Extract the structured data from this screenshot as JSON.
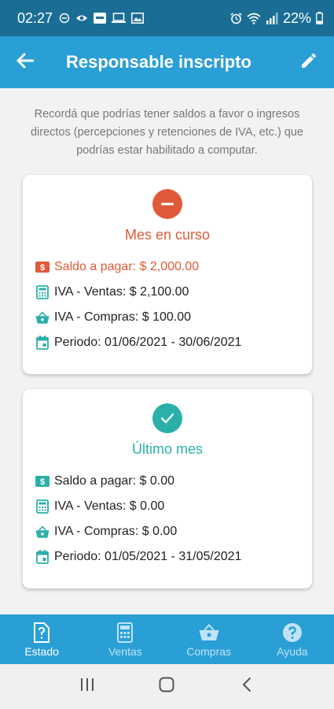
{
  "status_bar": {
    "time": "02:27",
    "battery": "22%",
    "icons_left": [
      "do-not-disturb-icon",
      "eye-icon",
      "app-icon",
      "laptop-icon",
      "gallery-icon"
    ],
    "icons_right": [
      "alarm-icon",
      "wifi-icon",
      "signal-icon",
      "battery-icon"
    ]
  },
  "app_bar": {
    "title": "Responsable inscripto",
    "back_icon": "arrow-back-icon",
    "edit_icon": "edit-pencil-icon"
  },
  "notice": "Recordá que podrías tener saldos a favor o ingresos directos (percepciones y retenciones de IVA, etc.) que podrías estar habilitado a computar.",
  "cards": [
    {
      "title": "Mes en curso",
      "badge_icon": "minus-circle-icon",
      "color": "#e05a3a",
      "rows": [
        {
          "icon": "money-icon",
          "text": "Saldo a pagar: $ 2,000.00"
        },
        {
          "icon": "calculator-icon",
          "text": "IVA - Ventas: $ 2,100.00"
        },
        {
          "icon": "basket-icon",
          "text": "IVA - Compras: $ 100.00"
        },
        {
          "icon": "calendar-icon",
          "text": "Periodo: 01/06/2021 - 30/06/2021"
        }
      ]
    },
    {
      "title": "Último mes",
      "badge_icon": "check-circle-icon",
      "color": "#2ab0a8",
      "rows": [
        {
          "icon": "money-icon",
          "text": "Saldo a pagar: $ 0.00"
        },
        {
          "icon": "calculator-icon",
          "text": "IVA - Ventas: $ 0.00"
        },
        {
          "icon": "basket-icon",
          "text": "IVA - Compras: $ 0.00"
        },
        {
          "icon": "calendar-icon",
          "text": "Periodo: 01/05/2021 - 31/05/2021"
        }
      ]
    }
  ],
  "bottom_nav": [
    {
      "label": "Estado",
      "icon": "document-question-icon",
      "active": true
    },
    {
      "label": "Ventas",
      "icon": "calculator-icon",
      "active": false
    },
    {
      "label": "Compras",
      "icon": "basket-icon",
      "active": false
    },
    {
      "label": "Ayuda",
      "icon": "help-circle-icon",
      "active": false
    }
  ],
  "colors": {
    "status_bar": "#1a6e95",
    "app_bar": "#2a9fd6",
    "accent_red": "#e05a3a",
    "accent_teal": "#2ab0a8"
  }
}
